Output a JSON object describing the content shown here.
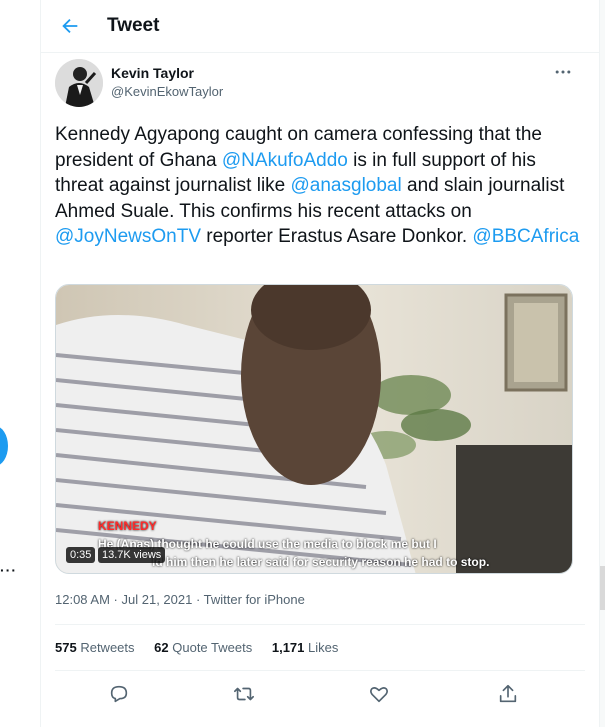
{
  "header": {
    "title": "Tweet",
    "back_icon": "arrow-left-icon"
  },
  "author": {
    "name": "Kevin Taylor",
    "handle": "@KevinEkowTaylor",
    "avatar_icon": "profile-photo",
    "more_icon": "more-horizontal-icon"
  },
  "tweet": {
    "t1": "Kennedy Agyapong caught on camera confessing that the president of Ghana ",
    "m1": "@NAkufoAddo",
    "t2": "  is in full support  of his threat against journalist like ",
    "m2": "@anasglobal",
    "t3": " and slain journalist Ahmed Suale. This confirms his recent attacks on ",
    "m3": "@JoyNewsOnTV",
    "t4": " reporter Erastus Asare Donkor. ",
    "m4": "@BBCAfrica"
  },
  "video": {
    "speaker": "KENNEDY",
    "caption_line1": "He (Anas) thought he could use the media to block me  but I",
    "caption_line2": "ld him then he later said for security reason he had to stop.",
    "duration": "0:35",
    "views": "13.7K views"
  },
  "meta": {
    "time": "12:08 AM",
    "separator": " · ",
    "date": "Jul 21, 2021",
    "source": "Twitter for iPhone"
  },
  "stats": {
    "retweets_count": "575",
    "retweets_label": "Retweets",
    "quotes_count": "62",
    "quotes_label": "Quote Tweets",
    "likes_count": "1,171",
    "likes_label": "Likes"
  },
  "actions": {
    "reply_icon": "reply-icon",
    "retweet_icon": "retweet-icon",
    "like_icon": "heart-icon",
    "share_icon": "share-icon"
  },
  "side": {
    "left_menu": "···"
  },
  "colors": {
    "accent": "#1d9bf0",
    "text": "#0f1419",
    "muted": "#536471",
    "border": "#eff3f4",
    "caption_speaker": "#ff2a2a"
  }
}
